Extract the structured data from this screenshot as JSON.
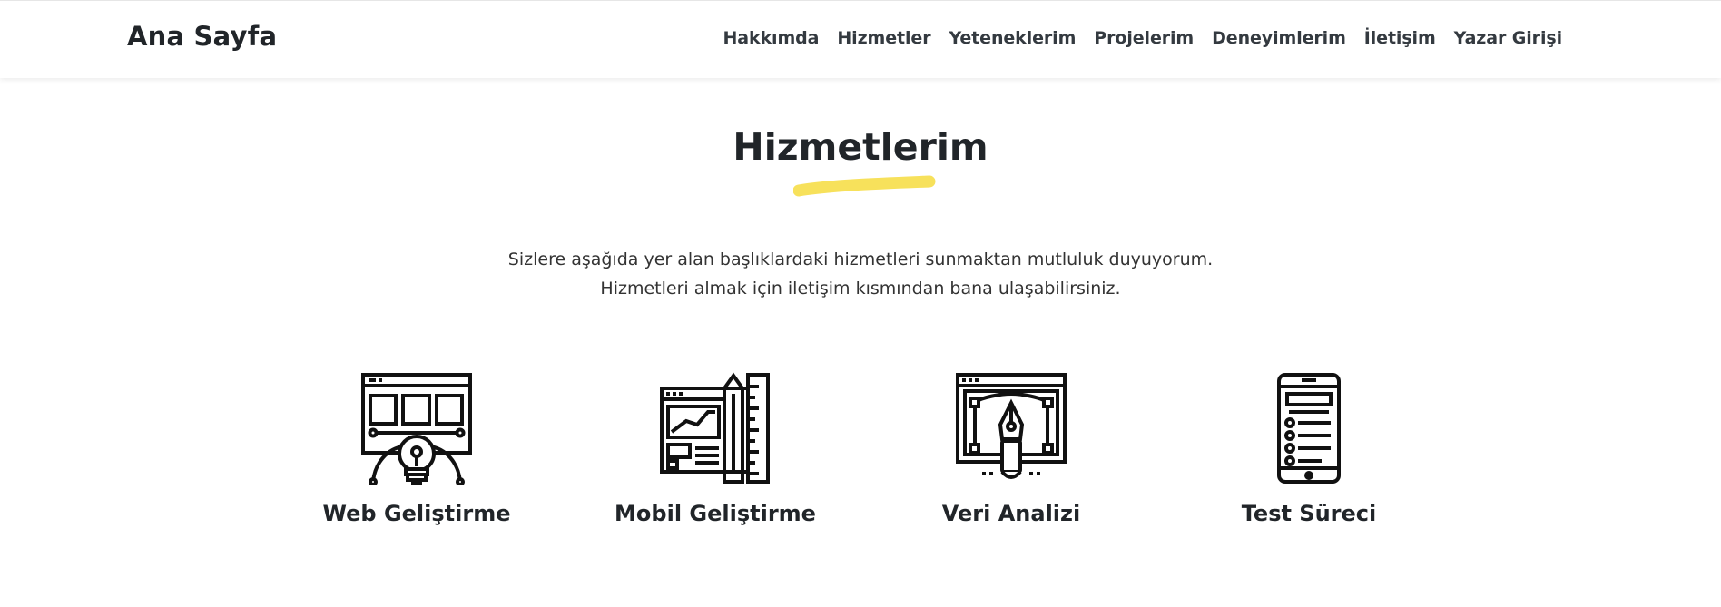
{
  "navbar": {
    "brand": "Ana Sayfa",
    "links": [
      "Hakkımda",
      "Hizmetler",
      "Yeteneklerim",
      "Projelerim",
      "Deneyimlerim",
      "İletişim",
      "Yazar Girişi"
    ]
  },
  "services_section": {
    "title": "Hizmetlerim",
    "accent_color": "#f7e15b",
    "intro_lines": [
      "Sizlere aşağıda yer alan başlıklardaki hizmetleri sunmaktan mutluluk duyuyorum.",
      "Hizmetleri almak için iletişim kısmından bana ulaşabilirsiniz."
    ],
    "items": [
      {
        "title": "Web Geliştirme",
        "icon": "web-development-icon"
      },
      {
        "title": "Mobil Geliştirme",
        "icon": "mobile-design-icon"
      },
      {
        "title": "Veri Analizi",
        "icon": "pen-tool-icon"
      },
      {
        "title": "Test Süreci",
        "icon": "smartphone-checklist-icon"
      }
    ]
  }
}
